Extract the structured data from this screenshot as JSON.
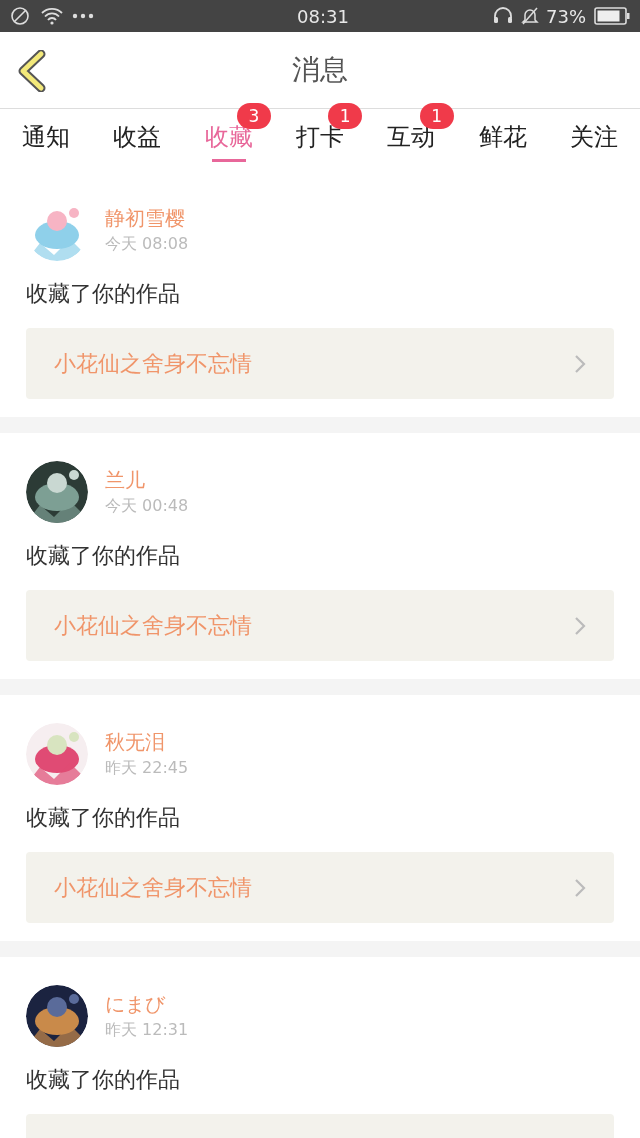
{
  "status_bar": {
    "time": "08:31",
    "battery": "73%"
  },
  "header": {
    "title": "消息"
  },
  "tabs": [
    {
      "label": "通知",
      "selected": false
    },
    {
      "label": "收益",
      "selected": false
    },
    {
      "label": "收藏",
      "selected": true,
      "badge": "3"
    },
    {
      "label": "打卡",
      "selected": false,
      "badge": "1"
    },
    {
      "label": "互动",
      "selected": false,
      "badge": "1"
    },
    {
      "label": "鲜花",
      "selected": false
    },
    {
      "label": "关注",
      "selected": false
    }
  ],
  "messages": [
    {
      "user": "静初雪樱",
      "time": "今天 08:08",
      "text": "收藏了你的作品",
      "work": "小花仙之舍身不忘情"
    },
    {
      "user": "兰儿",
      "time": "今天 00:48",
      "text": "收藏了你的作品",
      "work": "小花仙之舍身不忘情"
    },
    {
      "user": "秋无泪",
      "time": "昨天 22:45",
      "text": "收藏了你的作品",
      "work": "小花仙之舍身不忘情"
    },
    {
      "user": "にまび",
      "time": "昨天 12:31",
      "text": "收藏了你的作品"
    }
  ]
}
